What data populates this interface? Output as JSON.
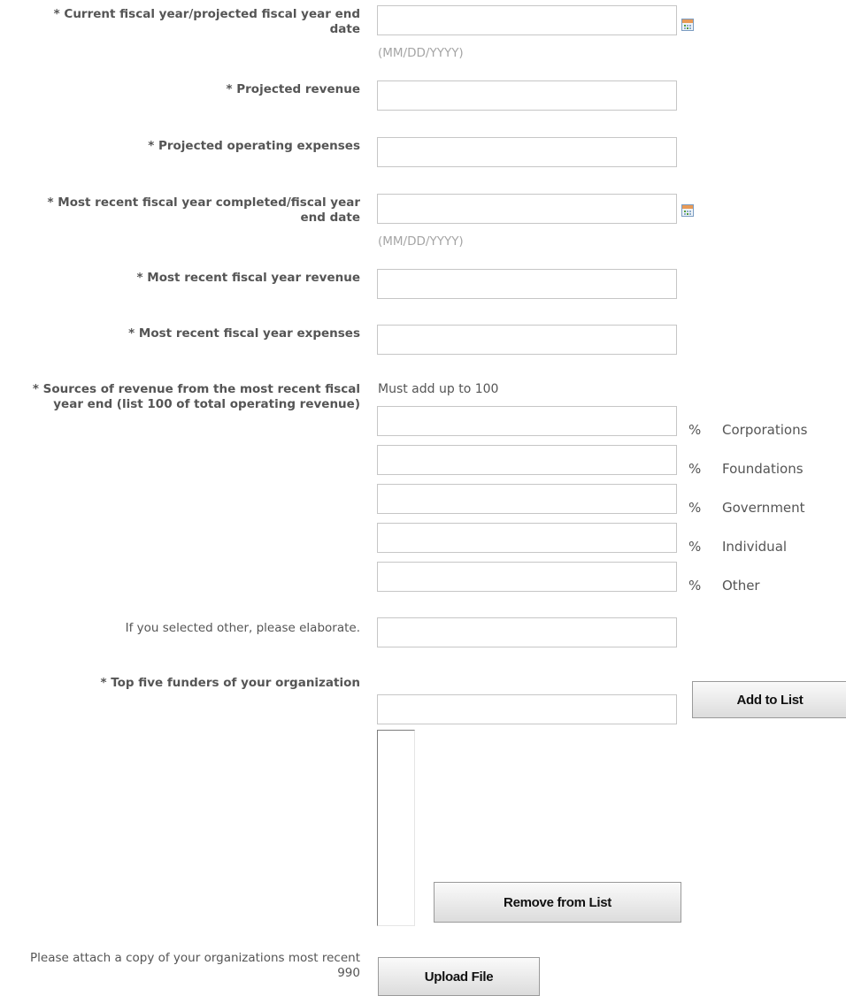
{
  "fields": {
    "current_fy_end": {
      "label": "* Current fiscal year/projected fiscal year end date",
      "value": "",
      "hint": "(MM/DD/YYYY)"
    },
    "projected_revenue": {
      "label": "* Projected revenue",
      "value": ""
    },
    "projected_expenses": {
      "label": "* Projected operating expenses",
      "value": ""
    },
    "recent_fy_end": {
      "label": "* Most recent fiscal year completed/fiscal year end date",
      "value": "",
      "hint": "(MM/DD/YYYY)"
    },
    "recent_revenue": {
      "label": "* Most recent fiscal year revenue",
      "value": ""
    },
    "recent_expenses": {
      "label": "* Most recent fiscal year expenses",
      "value": ""
    },
    "sources": {
      "label": "* Sources of revenue from the most recent fiscal year end (list 100 of total operating revenue)",
      "note": "Must add up to 100",
      "percent_symbol": "%",
      "items": [
        {
          "name": "Corporations",
          "value": ""
        },
        {
          "name": "Foundations",
          "value": ""
        },
        {
          "name": "Government",
          "value": ""
        },
        {
          "name": "Individual",
          "value": ""
        },
        {
          "name": "Other",
          "value": ""
        }
      ]
    },
    "other_elaborate": {
      "label": "If you selected other, please elaborate.",
      "value": ""
    },
    "top_funders": {
      "label": "* Top five funders of your organization",
      "value": "",
      "add_button": "Add to List",
      "remove_button": "Remove from List"
    },
    "attachment": {
      "label": "Please attach a copy of your organizations most recent 990",
      "upload_button": "Upload File"
    }
  },
  "icons": {
    "calendar": "calendar-icon"
  },
  "colors": {
    "label": "#555555",
    "hint": "#a5a5a5",
    "border": "#c6c6c6",
    "calendar_header": "#e89a56"
  }
}
